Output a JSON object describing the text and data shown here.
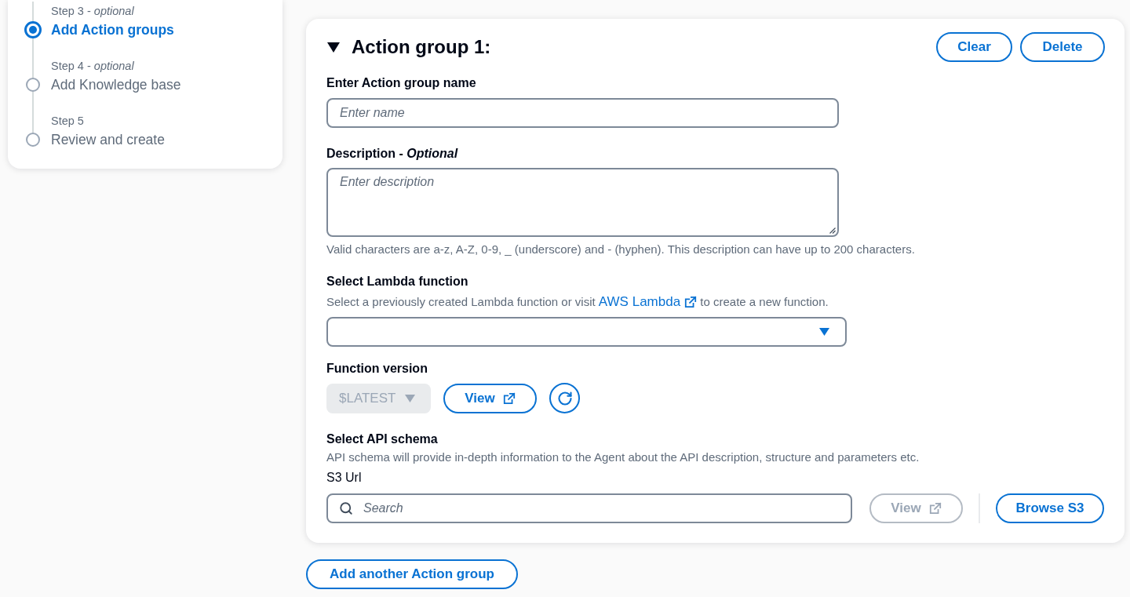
{
  "wizard_steps": [
    {
      "label": "Step 3 - *optional*",
      "title": "Add Action groups",
      "selected": true
    },
    {
      "label": "Step 4 - *optional*",
      "title": "Add Knowledge base",
      "selected": false
    },
    {
      "label": "Step 5",
      "title": "Review and create",
      "selected": false
    }
  ],
  "action_group": {
    "title": "Action group 1:",
    "expanded": true,
    "buttons": [
      {
        "label": "Clear"
      },
      {
        "label": "Delete"
      }
    ],
    "name_field": {
      "label": "Enter Action group name",
      "placeholder": "Enter name"
    },
    "description_field": {
      "label": "Description - *Optional*",
      "placeholder": "Enter description",
      "hint": "Valid characters are a-z, A-Z, 0-9, _ (underscore) and - (hyphen). This description can have up to 200 characters."
    },
    "lambda": {
      "label": "Select Lambda function",
      "description_before": "Select a previously created Lambda function or visit",
      "link": "AWS Lambda",
      "description_after": "to create a new function."
    },
    "function_version": {
      "label": "Function version",
      "select": {
        "value": "$LATEST",
        "disabled": true
      },
      "view_button": {
        "label": "View",
        "disabled": false
      }
    },
    "api_schema": {
      "label": "Select API schema",
      "description": "API schema will provide in-depth information to the Agent about the API description, structure and parameters etc.",
      "source_label": "S3 Url",
      "search_placeholder": "Search",
      "view_button": {
        "label": "View",
        "disabled": true
      },
      "browse_button": {
        "label": "Browse S3",
        "disabled": false
      }
    }
  },
  "add_button": "Add another Action group"
}
